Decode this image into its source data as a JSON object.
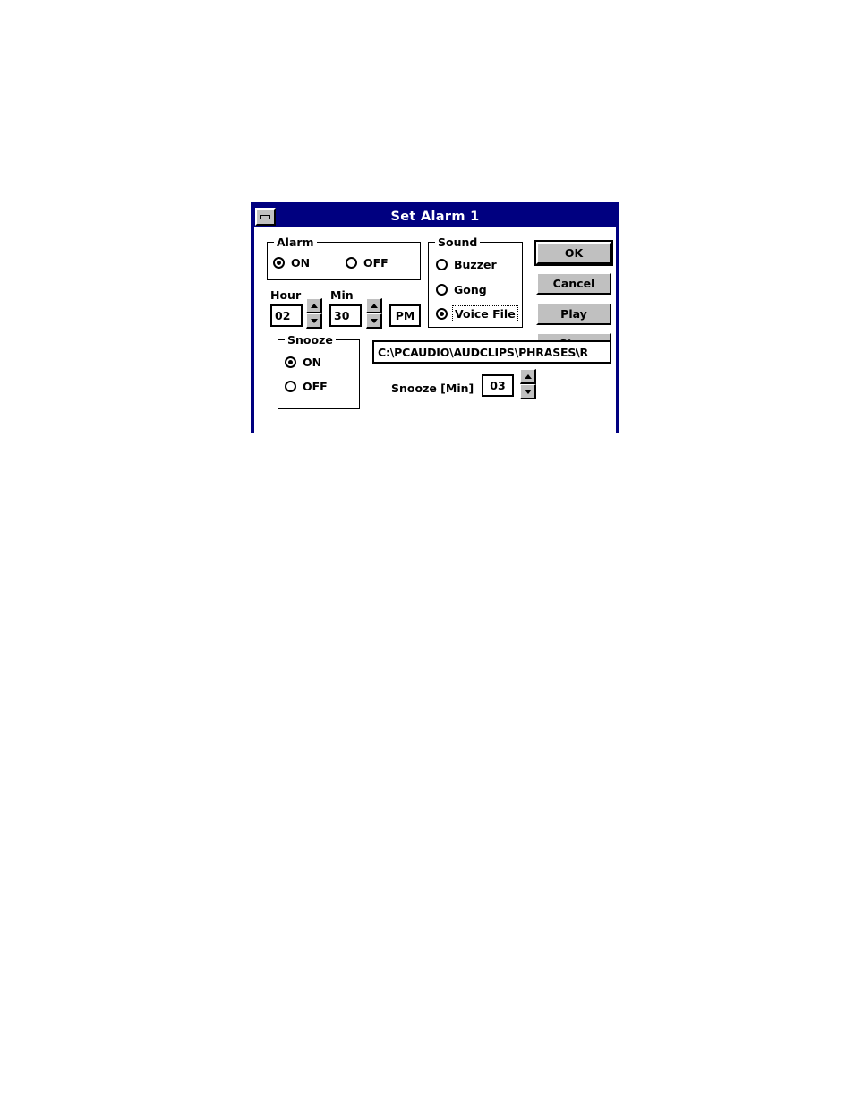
{
  "window": {
    "title": "Set Alarm 1",
    "minimize_icon": "minimize-icon",
    "titlebar_color": "#000080",
    "face_color": "#c0c0c0",
    "client_color": "#ffffff"
  },
  "alarm_group": {
    "legend": "Alarm",
    "options": [
      {
        "label": "ON",
        "selected": true
      },
      {
        "label": "OFF",
        "selected": false
      }
    ]
  },
  "time": {
    "hour_label": "Hour",
    "hour_value": "02",
    "min_label": "Min",
    "min_value": "30",
    "meridiem_value": "PM",
    "hour_spinner": {
      "up_icon": "arrow-up-icon",
      "down_icon": "arrow-down-icon"
    },
    "min_spinner": {
      "up_icon": "arrow-up-icon",
      "down_icon": "arrow-down-icon"
    }
  },
  "sound_group": {
    "legend": "Sound",
    "options": [
      {
        "label": "Buzzer",
        "selected": false,
        "focused": false
      },
      {
        "label": "Gong",
        "selected": false,
        "focused": false
      },
      {
        "label": "Voice File",
        "selected": true,
        "focused": true
      }
    ]
  },
  "snooze_group": {
    "legend": "Snooze",
    "options": [
      {
        "label": "ON",
        "selected": true
      },
      {
        "label": "OFF",
        "selected": false
      }
    ]
  },
  "voice_file": {
    "path": "C:\\PCAUDIO\\AUDCLIPS\\PHRASES\\R"
  },
  "snooze_minutes": {
    "label": "Snooze [Min]",
    "value": "03",
    "spinner": {
      "up_icon": "arrow-up-icon",
      "down_icon": "arrow-down-icon"
    }
  },
  "buttons": {
    "ok": "OK",
    "cancel": "Cancel",
    "play": "Play",
    "stop": "Stop"
  }
}
